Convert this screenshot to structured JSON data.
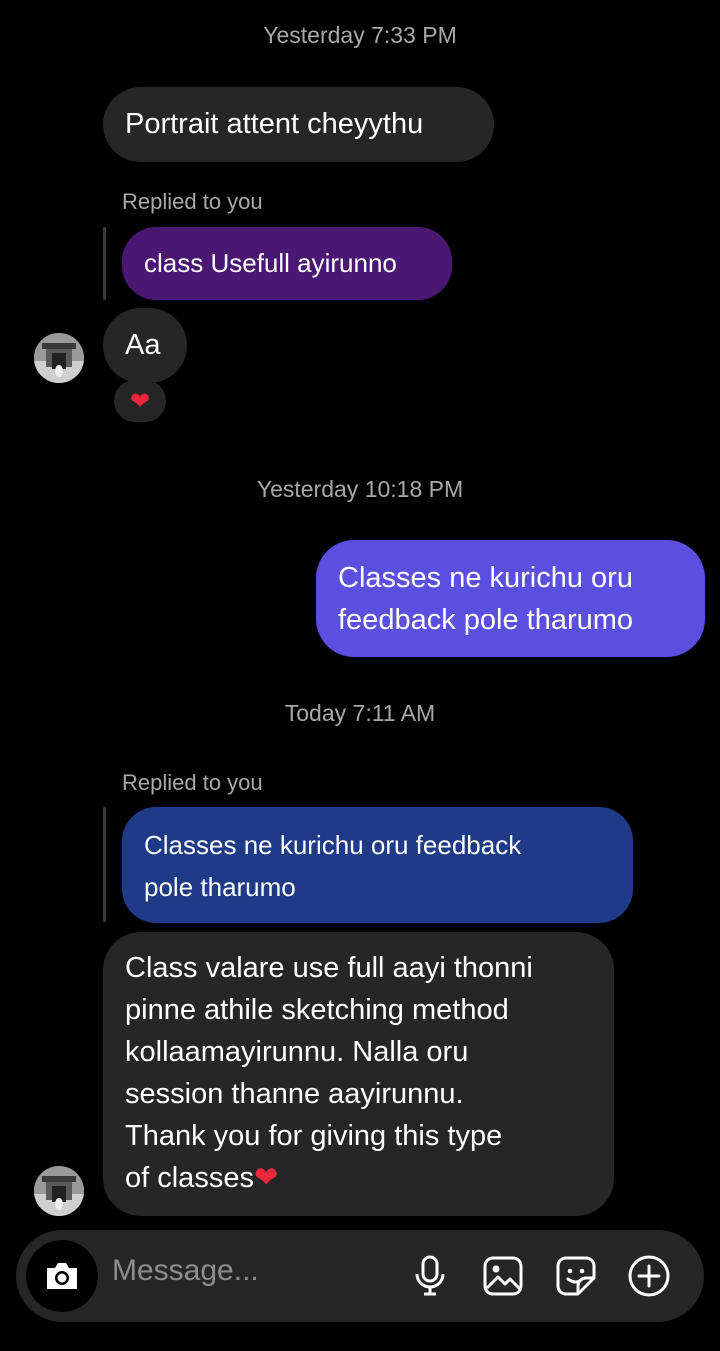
{
  "messages": {
    "ts1": "Yesterday 7:33 PM",
    "m1": "Portrait attent cheyythu",
    "reply1_label": "Replied to you",
    "reply1_quote": "class Usefull ayirunno",
    "m2": "Aa",
    "reaction": "❤",
    "ts2": "Yesterday 10:18 PM",
    "m3_line1": "Classes ne kurichu oru",
    "m3_line2": "feedback pole tharumo",
    "ts3": "Today 7:11 AM",
    "reply2_label": "Replied to you",
    "reply2_quote_line1": "Classes ne kurichu oru feedback",
    "reply2_quote_line2": "pole tharumo",
    "m4_lines": [
      "Class valare use full aayi thonni",
      "pinne athile sketching method",
      "kollaamayirunnu. Nalla oru",
      "session thanne aayirunnu.",
      "Thank you for giving this type",
      "of classes"
    ],
    "m4_heart": "❤"
  },
  "composer": {
    "placeholder": "Message...",
    "icons": [
      "camera-icon",
      "microphone-icon",
      "gallery-icon",
      "sticker-icon",
      "plus-circle-icon"
    ]
  },
  "colors": {
    "background": "#000000",
    "incoming_bubble": "#262626",
    "outgoing_bubble": "#5b4fe0",
    "reply_quote_purple": "#4a1772",
    "reply_quote_blue": "#1f3a86",
    "timestamp": "#a8a8a8"
  }
}
